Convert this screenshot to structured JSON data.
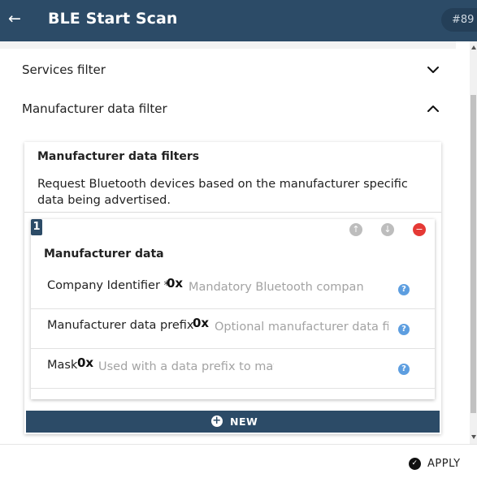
{
  "header": {
    "back_icon": "arrow-left-icon",
    "title": "BLE Start Scan",
    "badge": "#89",
    "background": "#2c4b67"
  },
  "sections": {
    "services_filter": {
      "label": "Services filter",
      "expanded": false,
      "icon": "chevron-down-icon"
    },
    "manufacturer_filter": {
      "label": "Manufacturer data filter",
      "expanded": true,
      "icon": "chevron-up-icon"
    }
  },
  "card": {
    "title": "Manufacturer data filters",
    "description": "Request Bluetooth devices based on the manufacturer specific data being advertised."
  },
  "item": {
    "index": "1",
    "controls": {
      "move_up_icon": "arrow-up-icon",
      "move_down_icon": "arrow-down-icon",
      "remove_icon": "remove-icon"
    },
    "title": "Manufacturer data",
    "fields": [
      {
        "label": "Company Identifier *",
        "prefix": "0x",
        "value": "",
        "placeholder": "Mandatory Bluetooth company identifier",
        "help_icon": "help-icon"
      },
      {
        "label": "Manufacturer data prefix",
        "prefix": "0x",
        "value": "",
        "placeholder": "Optional manufacturer data filter",
        "help_icon": "help-icon"
      },
      {
        "label": "Mask",
        "prefix": "0x",
        "value": "",
        "placeholder": "Used with a data prefix to match",
        "help_icon": "help-icon"
      }
    ]
  },
  "new_button": {
    "label": "NEW",
    "icon": "plus-circle-icon"
  },
  "footer": {
    "apply_label": "APPLY",
    "apply_icon": "check-circle-icon"
  },
  "colors": {
    "primary": "#2c4b67",
    "remove": "#e53935",
    "help": "#5d9ee0"
  }
}
